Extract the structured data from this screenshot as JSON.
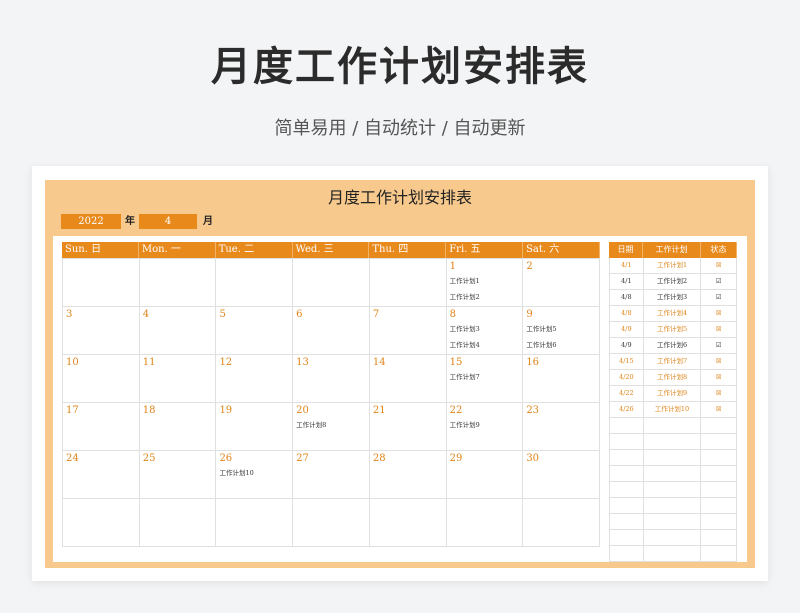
{
  "page": {
    "title": "月度工作计划安排表",
    "subtitle": "简单易用 / 自动统计 / 自动更新"
  },
  "sheet": {
    "title": "月度工作计划安排表",
    "year": "2022",
    "year_label": "年",
    "month": "4",
    "month_label": "月",
    "accent_color": "#e8891c",
    "frame_color": "#f7c98c"
  },
  "calendar": {
    "weekdays": [
      "Sun. 日",
      "Mon. 一",
      "Tue. 二",
      "Wed. 三",
      "Thu. 四",
      "Fri. 五",
      "Sat. 六"
    ],
    "weeks": [
      [
        {
          "day": "",
          "tasks": []
        },
        {
          "day": "",
          "tasks": []
        },
        {
          "day": "",
          "tasks": []
        },
        {
          "day": "",
          "tasks": []
        },
        {
          "day": "",
          "tasks": []
        },
        {
          "day": "1",
          "tasks": [
            "工作计划1",
            "工作计划2"
          ]
        },
        {
          "day": "2",
          "tasks": []
        }
      ],
      [
        {
          "day": "3",
          "tasks": []
        },
        {
          "day": "4",
          "tasks": []
        },
        {
          "day": "5",
          "tasks": []
        },
        {
          "day": "6",
          "tasks": []
        },
        {
          "day": "7",
          "tasks": []
        },
        {
          "day": "8",
          "tasks": [
            "工作计划3",
            "工作计划4"
          ]
        },
        {
          "day": "9",
          "tasks": [
            "工作计划5",
            "工作计划6"
          ]
        }
      ],
      [
        {
          "day": "10",
          "tasks": []
        },
        {
          "day": "11",
          "tasks": []
        },
        {
          "day": "12",
          "tasks": []
        },
        {
          "day": "13",
          "tasks": []
        },
        {
          "day": "14",
          "tasks": []
        },
        {
          "day": "15",
          "tasks": [
            "工作计划7"
          ]
        },
        {
          "day": "16",
          "tasks": []
        }
      ],
      [
        {
          "day": "17",
          "tasks": []
        },
        {
          "day": "18",
          "tasks": []
        },
        {
          "day": "19",
          "tasks": []
        },
        {
          "day": "20",
          "tasks": [
            "工作计划8"
          ]
        },
        {
          "day": "21",
          "tasks": []
        },
        {
          "day": "22",
          "tasks": [
            "工作计划9"
          ]
        },
        {
          "day": "23",
          "tasks": []
        }
      ],
      [
        {
          "day": "24",
          "tasks": []
        },
        {
          "day": "25",
          "tasks": []
        },
        {
          "day": "26",
          "tasks": [
            "工作计划10"
          ]
        },
        {
          "day": "27",
          "tasks": []
        },
        {
          "day": "28",
          "tasks": []
        },
        {
          "day": "29",
          "tasks": []
        },
        {
          "day": "30",
          "tasks": []
        }
      ],
      [
        {
          "day": "",
          "tasks": []
        },
        {
          "day": "",
          "tasks": []
        },
        {
          "day": "",
          "tasks": []
        },
        {
          "day": "",
          "tasks": []
        },
        {
          "day": "",
          "tasks": []
        },
        {
          "day": "",
          "tasks": []
        },
        {
          "day": "",
          "tasks": []
        }
      ]
    ]
  },
  "side_table": {
    "headers": [
      "日期",
      "工作计划",
      "状态"
    ],
    "rows": [
      {
        "date": "4/1",
        "plan": "工作计划1",
        "status": "☒",
        "done": false
      },
      {
        "date": "4/1",
        "plan": "工作计划2",
        "status": "☑",
        "done": true
      },
      {
        "date": "4/8",
        "plan": "工作计划3",
        "status": "☑",
        "done": true
      },
      {
        "date": "4/8",
        "plan": "工作计划4",
        "status": "☒",
        "done": false
      },
      {
        "date": "4/9",
        "plan": "工作计划5",
        "status": "☒",
        "done": false
      },
      {
        "date": "4/9",
        "plan": "工作计划6",
        "status": "☑",
        "done": true
      },
      {
        "date": "4/15",
        "plan": "工作计划7",
        "status": "☒",
        "done": false
      },
      {
        "date": "4/20",
        "plan": "工作计划8",
        "status": "☒",
        "done": false
      },
      {
        "date": "4/22",
        "plan": "工作计划9",
        "status": "☒",
        "done": false
      },
      {
        "date": "4/26",
        "plan": "工作计划10",
        "status": "☒",
        "done": false
      }
    ],
    "empty_rows": 9
  }
}
